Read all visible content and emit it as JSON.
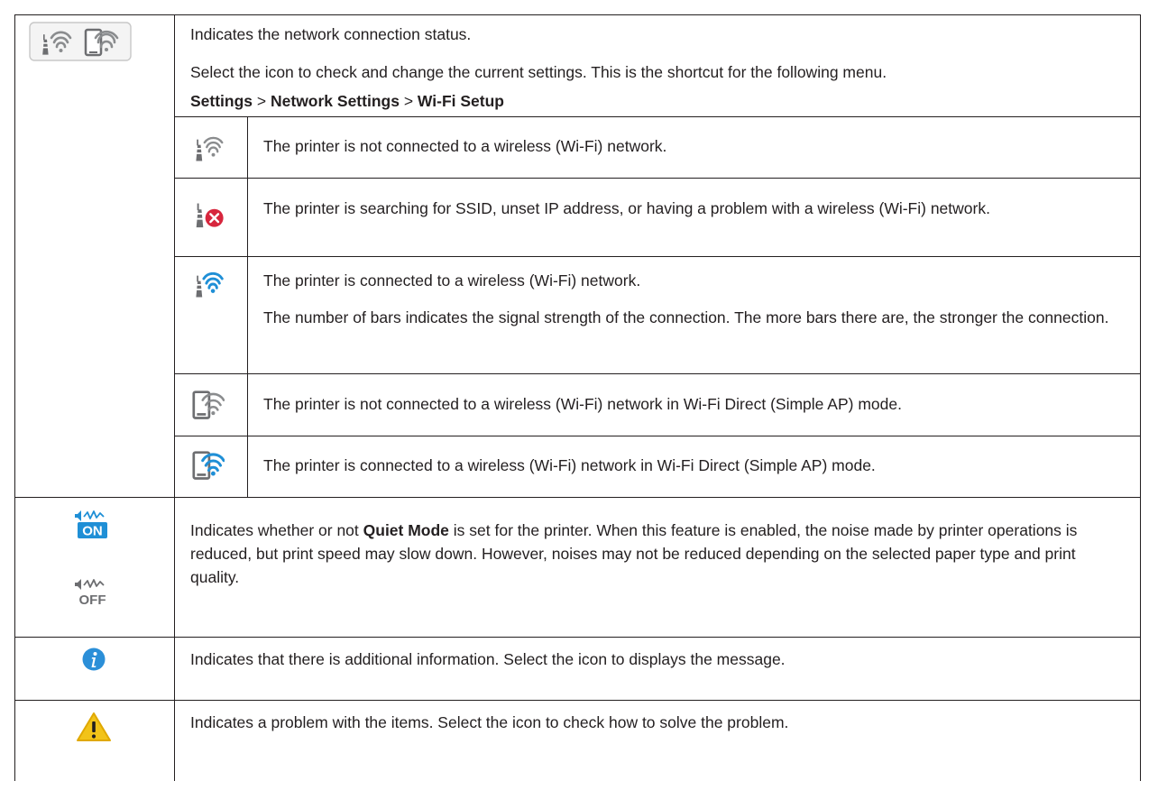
{
  "network": {
    "description": "Indicates the network connection status.",
    "instruction": "Select the icon to check and change the current settings. This is the shortcut for the following menu.",
    "menu_path": {
      "item1": "Settings",
      "sep1": " > ",
      "item2": "Network Settings",
      "sep2": " > ",
      "item3": "Wi-Fi Setup"
    },
    "states": [
      {
        "icon": "wifi-disconnected-icon",
        "text": "The printer is not connected to a wireless (Wi-Fi) network."
      },
      {
        "icon": "wifi-error-icon",
        "text": "The printer is searching for SSID, unset IP address, or having a problem with a wireless (Wi-Fi) network."
      },
      {
        "icon": "wifi-connected-icon",
        "text": "The printer is connected to a wireless (Wi-Fi) network.",
        "text2": "The number of bars indicates the signal strength of the connection. The more bars there are, the stronger the connection."
      },
      {
        "icon": "wifi-direct-disconnected-icon",
        "text": "The printer is not connected to a wireless (Wi-Fi) network in Wi-Fi Direct (Simple AP) mode."
      },
      {
        "icon": "wifi-direct-connected-icon",
        "text": "The printer is connected to a wireless (Wi-Fi) network in Wi-Fi Direct (Simple AP) mode."
      }
    ]
  },
  "quiet_mode": {
    "text_before": "Indicates whether or not ",
    "term": "Quiet Mode",
    "text_after": " is set for the printer. When this feature is enabled, the noise made by printer operations is reduced, but print speed may slow down. However, noises may not be reduced depending on the selected paper type and print quality.",
    "icon_on_label": "ON",
    "icon_off_label": "OFF"
  },
  "info": {
    "text": "Indicates that there is additional information. Select the icon to displays the message."
  },
  "warning": {
    "text": "Indicates a problem with the items. Select the icon to check how to solve the problem."
  },
  "colors": {
    "wifi_blue": "#1f8fd6",
    "error_red": "#d7263d",
    "warning_yellow": "#f2c318",
    "info_blue": "#2b8fd8",
    "icon_gray": "#6d6e71"
  }
}
